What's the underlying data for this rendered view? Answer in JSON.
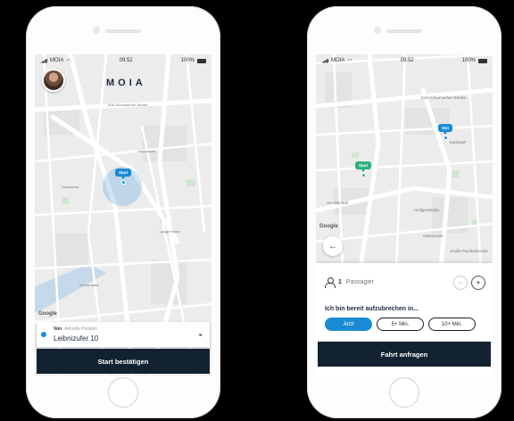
{
  "colors": {
    "accent": "#1a8ad4",
    "dark": "#132230",
    "start_pin": "#2fb07a"
  },
  "status": {
    "carrier": "MOIA",
    "time": "09:52",
    "battery": "100%"
  },
  "screen1": {
    "logo": "MOIA",
    "map": {
      "streets": [
        "Kurt-Schumacher-Straße",
        "Steindamm",
        "Holzdamm",
        "Lange Reihe",
        "Kirchenallee"
      ],
      "pin_label": "Start",
      "attribution": "Google"
    },
    "from_card": {
      "label": "Von",
      "hint": "Aktuelle Position",
      "address": "Leibnizufer 10"
    },
    "cta": "Start bestätigen"
  },
  "screen2": {
    "map": {
      "streets": [
        "Kurt-Schumacher-Straße",
        "Karlstadt",
        "Am Marstall",
        "Heiligerstraße",
        "Otterstraße",
        "Große Packhofstraße"
      ],
      "from_pin": "Von",
      "start_pin": "Start",
      "attribution": "Google"
    },
    "back_icon": "arrow-left-icon",
    "passengers": {
      "count": "1",
      "label": "Passagier"
    },
    "ready_text": "Ich bin bereit aufzubrechen in...",
    "time_options": [
      "Jetzt",
      "5+ Min.",
      "10+ Min."
    ],
    "selected_option": "Jetzt",
    "cta": "Fahrt anfragen"
  }
}
